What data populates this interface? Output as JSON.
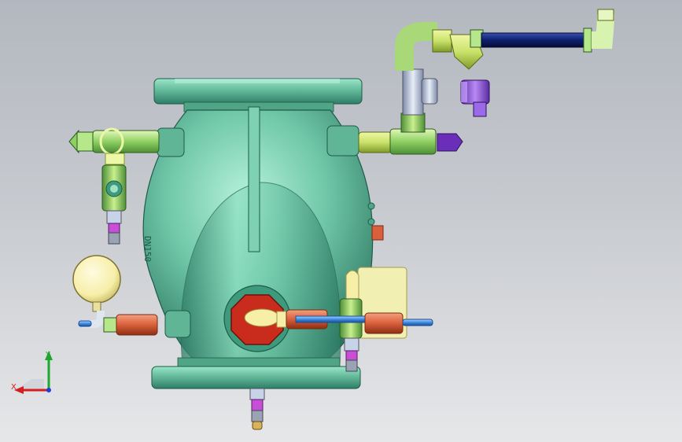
{
  "viewport": {
    "background_top": "#b3b7bf",
    "background_bottom": "#e6e7e9"
  },
  "colors": {
    "valve_body": "#6fc7a8",
    "valve_dark": "#2f7d66",
    "pipe_green": "#9ad86e",
    "pipe_yellowgreen": "#c9e26a",
    "pipe_navy": "#0d1f6e",
    "pipe_blue": "#3f8ce0",
    "fitting_orange": "#d9603a",
    "fitting_red": "#c92c1c",
    "gauge_cream": "#f7eea8",
    "solenoid_purple": "#8a4fd6",
    "inspection_steel": "#b8c4dc"
  },
  "triad": {
    "x_label": "X",
    "y_label": "Y",
    "x_color": "#d21f1f",
    "y_color": "#1fa62f",
    "z_color": "#1f3fd6"
  },
  "stamp_text": "DN150"
}
